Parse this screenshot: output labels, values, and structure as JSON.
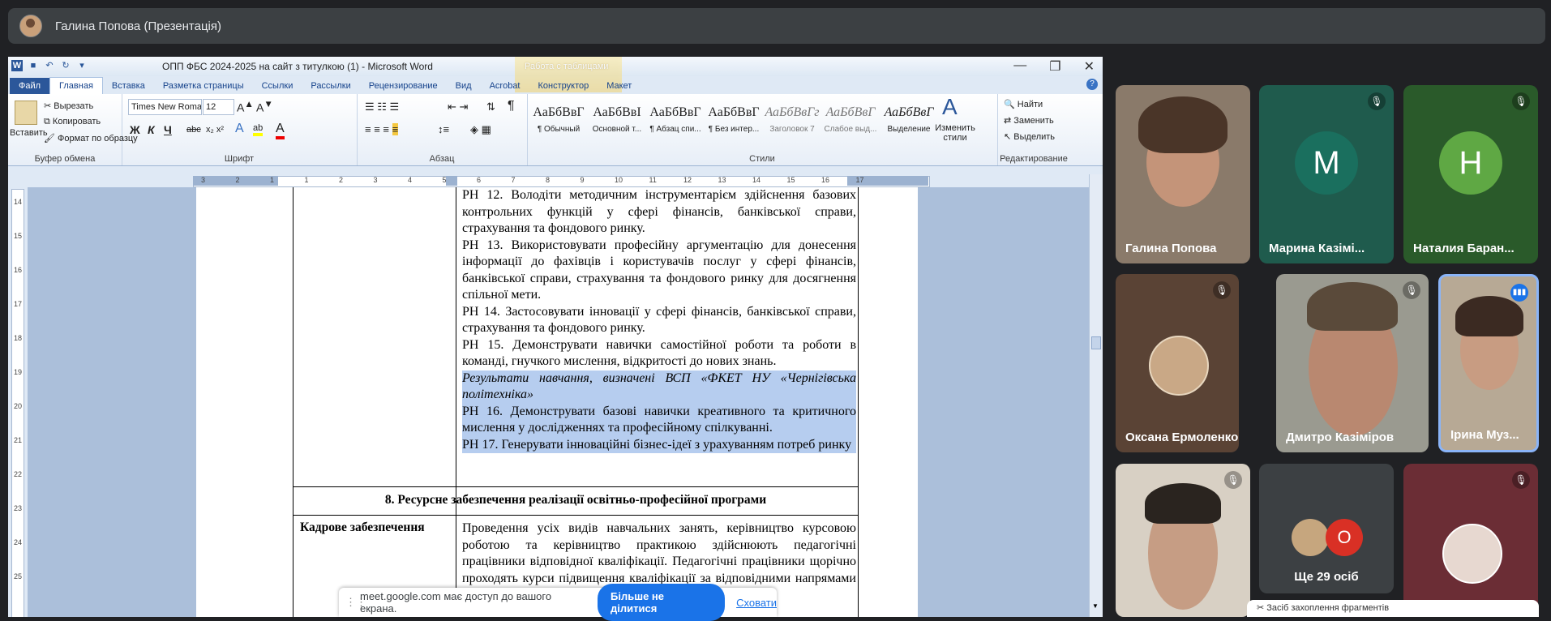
{
  "meet": {
    "presenter": "Галина Попова (Презентація)",
    "share_bar": {
      "text": "meet.google.com має доступ до вашого екрана.",
      "stop_button": "Більше не ділитися",
      "hide_link": "Сховати"
    },
    "participants": [
      {
        "name": "Галина Попова",
        "muted": false
      },
      {
        "name": "Марина Казімі...",
        "initial": "M",
        "muted": true,
        "color": "#1e8e6f"
      },
      {
        "name": "Наталия Баран...",
        "initial": "H",
        "muted": true,
        "color": "#5fa844"
      },
      {
        "name": "Оксана Ермоленко",
        "muted": true
      },
      {
        "name": "Дмитро Казіміров",
        "muted": true
      },
      {
        "name": "Ірина Муз...",
        "muted": false,
        "speaking": true
      }
    ],
    "more": {
      "label": "Ще 29 осіб",
      "initial": "О"
    },
    "snip_notice": "Засіб захоплення фрагментів"
  },
  "word": {
    "title": "ОПП ФБС 2024-2025 на сайт з титулкою (1) - Microsoft Word",
    "context_tab": "Работа с таблицами",
    "tabs": [
      "Файл",
      "Главная",
      "Вставка",
      "Разметка страницы",
      "Ссылки",
      "Рассылки",
      "Рецензирование",
      "Вид",
      "Acrobat",
      "Конструктор",
      "Макет"
    ],
    "active_tab": "Главная",
    "clipboard": {
      "paste": "Вставить",
      "cut": "Вырезать",
      "copy": "Копировать",
      "format": "Формат по образцу",
      "label": "Буфер обмена"
    },
    "font": {
      "name": "Times New Roman",
      "size": "12",
      "label": "Шрифт"
    },
    "paragraph_label": "Абзац",
    "styles": {
      "label": "Стили",
      "items": [
        {
          "preview": "АаБбВвГ",
          "name": "¶ Обычный"
        },
        {
          "preview": "АаБбВвІ",
          "name": "Основной т..."
        },
        {
          "preview": "АаБбВвГ",
          "name": "¶ Абзац спи..."
        },
        {
          "preview": "АаБбВвГ",
          "name": "¶ Без интер..."
        },
        {
          "preview": "АаБбВвГг",
          "name": "Заголовок 7"
        },
        {
          "preview": "АаБбВвГ",
          "name": "Слабое выд..."
        },
        {
          "preview": "АаБбВвГ",
          "name": "Выделение"
        }
      ],
      "change": "Изменить стили"
    },
    "editing": {
      "find": "Найти",
      "replace": "Заменить",
      "select": "Выделить",
      "label": "Редактирование"
    },
    "ruler_numbers": [
      "3",
      "2",
      "1",
      "1",
      "2",
      "3",
      "4",
      "5",
      "6",
      "7",
      "8",
      "9",
      "10",
      "11",
      "12",
      "13",
      "14",
      "15",
      "16",
      "17"
    ],
    "vruler_numbers": [
      "14",
      "15",
      "16",
      "17",
      "18",
      "19",
      "20",
      "21",
      "22",
      "23",
      "24",
      "25"
    ],
    "doc": {
      "ph12": "РН 12. Володіти методичним інструментарієм здійснення базових контрольних функцій у сфері фінансів, банківської справи, страхування та фондового ринку.",
      "ph13": "РН 13. Використовувати професійну аргументацію для донесення інформації до фахівців і користувачів послуг у сфері фінансів, банківської справи, страхування та фондового ринку для досягнення спільної мети.",
      "ph14": "РН 14. Застосовувати інновації у сфері фінансів, банківської справи, страхування та фондового ринку.",
      "ph15": "РН 15. Демонструвати навички самостійної роботи та роботи в команді, гнучкого мислення, відкритості до нових знань.",
      "results_heading": "Результати навчання, визначені ВСП «ФКЕТ НУ «Чернігівська політехніка»",
      "ph16": "РН 16. Демонструвати базові навички креативного та критичного мислення у дослідженнях та професійному спілкуванні.",
      "ph17": "РН 17. Генерувати інноваційні бізнес-ідеї з урахуванням потреб ринку",
      "section8": "8. Ресурсне забезпечення реалізації освітньо-професійної програми",
      "staff_label": "Кадрове забезпечення",
      "staff_text": "Проведення усіх видів навчальних занять, керівництво курсовою роботою та керівництво практикою здійснюють педагогічні працівники відповідної кваліфікації. Педагогічні працівники щорічно проходять курси підвищення кваліфікації за відповідними напрямами та ... кваліфікації."
    }
  }
}
